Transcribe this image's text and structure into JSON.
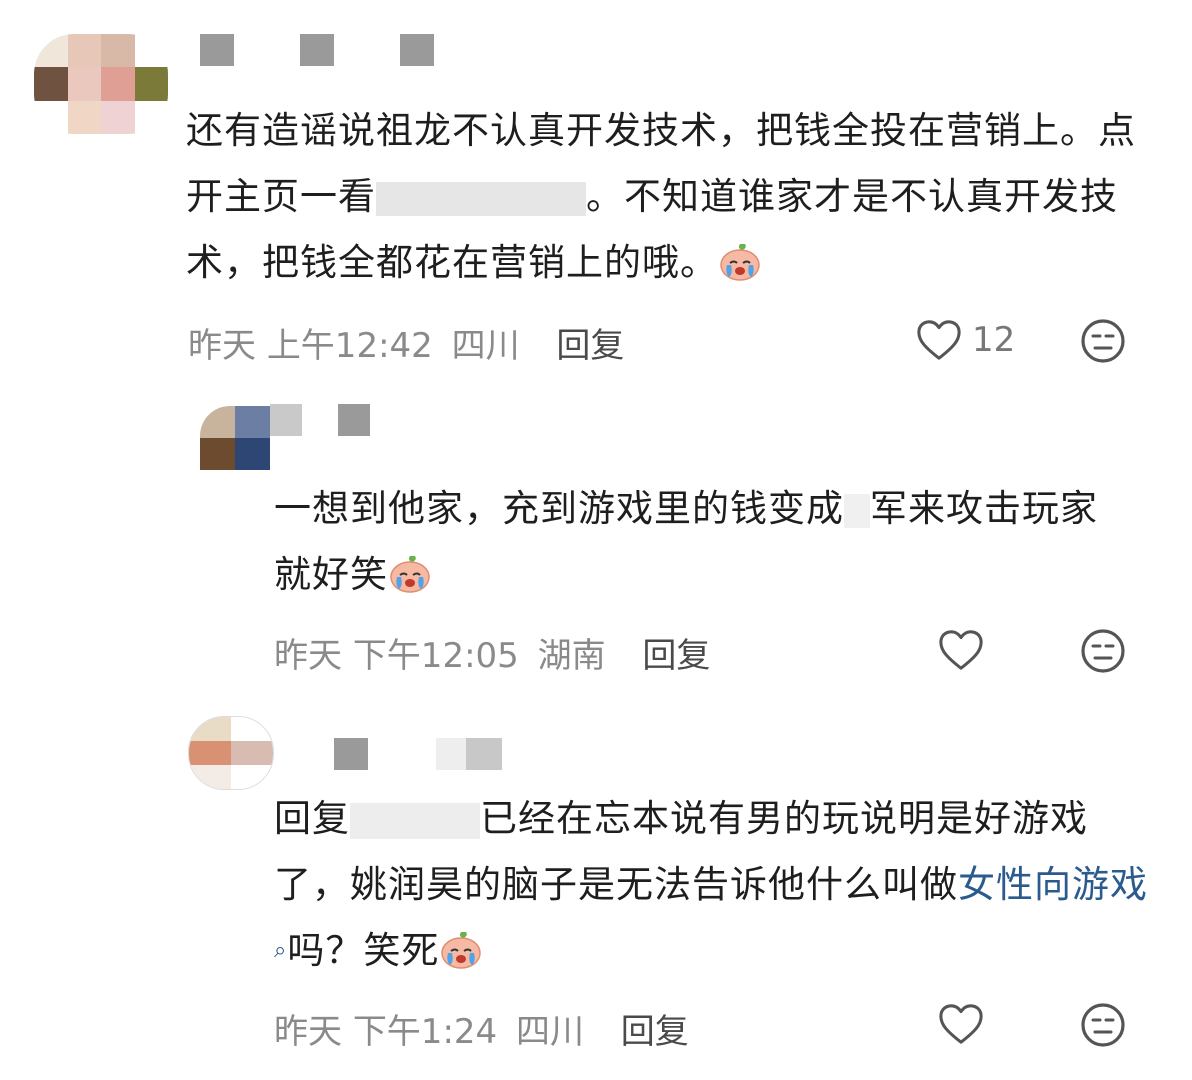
{
  "comments": [
    {
      "text_before": "还有造谣说祖龙不认真开发技术，把钱全投在营销上。点开主页一看",
      "text_mid": "",
      "text_after": "。不知道谁家才是不认真开发技术，把钱全都花在营销上的哦。",
      "date": "昨天",
      "time": "上午12:42",
      "location": "四川",
      "reply_label": "回复",
      "likes": "12",
      "emoji_icon": "crying-face-icon"
    },
    {
      "text_before": "一想到他家，充到游戏里的钱变成",
      "text_after": "军来攻击玩家就好笑",
      "date": "昨天",
      "time": "下午12:05",
      "location": "湖南",
      "reply_label": "回复",
      "likes": "",
      "emoji_icon": "crying-face-icon"
    },
    {
      "prefix": "回复",
      "text_before": "已经在忘本说有男的玩说明是好游戏了，姚润昊的脑子是无法告诉他什么叫做",
      "link": "女性向游戏",
      "text_after": "吗？笑死",
      "date": "昨天",
      "time": "下午1:24",
      "location": "四川",
      "reply_label": "回复",
      "likes": "",
      "emoji_icon": "crying-face-icon"
    }
  ],
  "colors": {
    "link": "#2b5b8c",
    "meta": "#8a8a8a"
  }
}
